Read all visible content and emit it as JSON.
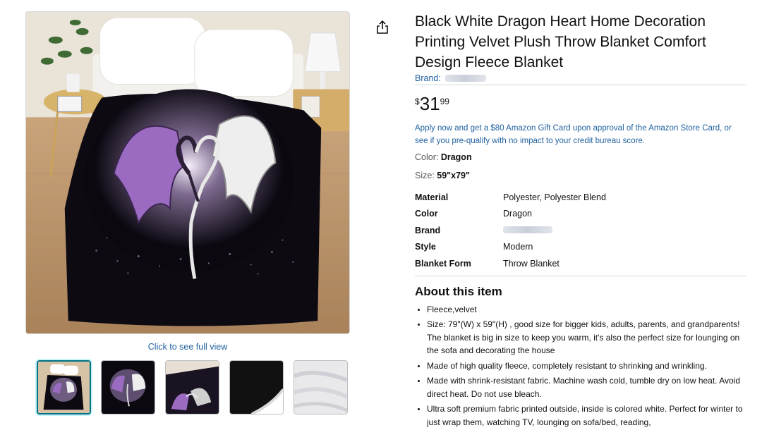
{
  "product": {
    "title": "Black White Dragon Heart Home Decoration Printing Velvet Plush Throw Blanket Comfort Design Fleece Blanket",
    "brand_label": "Brand:",
    "price": {
      "symbol": "$",
      "whole": "31",
      "fraction": "99"
    },
    "promo": "Apply now and get a $80 Amazon Gift Card upon approval of the Amazon Store Card, or see if you pre-qualify with no impact to your credit bureau score.",
    "color_label": "Color:",
    "color_value": "Dragon",
    "size_label": "Size:",
    "size_value": "59\"x79\""
  },
  "attributes": [
    {
      "key": "Material",
      "value": "Polyester, Polyester Blend"
    },
    {
      "key": "Color",
      "value": "Dragon"
    },
    {
      "key": "Brand",
      "value": ""
    },
    {
      "key": "Style",
      "value": "Modern"
    },
    {
      "key": "Blanket Form",
      "value": "Throw Blanket"
    }
  ],
  "about": {
    "heading": "About this item",
    "bullets": [
      "Fleece,velvet",
      "Size: 79\"(W) x 59\"(H) , good size for bigger kids, adults, parents, and grandparents! The blanket is big in size to keep you warm, it's also the perfect size for lounging on the sofa and decorating the house",
      "Made of high quality fleece, completely resistant to shrinking and wrinkling.",
      "Made with shrink-resistant fabric. Machine wash cold, tumble dry on low heat. Avoid direct heat. Do not use bleach.",
      "Ultra soft premium fabric printed outside, inside is colored white. Perfect for winter to just wrap them, watching TV, lounging on sofa/bed, reading,"
    ]
  },
  "gallery": {
    "click_full_view": "Click to see full view",
    "thumbnails": [
      "bedroom-scene",
      "dragon-print-front",
      "dragon-print-corner",
      "black-edge-detail",
      "white-fleece-reverse"
    ],
    "selected_index": 0
  },
  "icons": {
    "share": "share-icon"
  },
  "colors": {
    "link": "#2162a1",
    "text": "#0f1111",
    "divider": "#d5d9d9",
    "thumb_selected": "#007185",
    "dragon_purple": "#9a6bc0"
  }
}
